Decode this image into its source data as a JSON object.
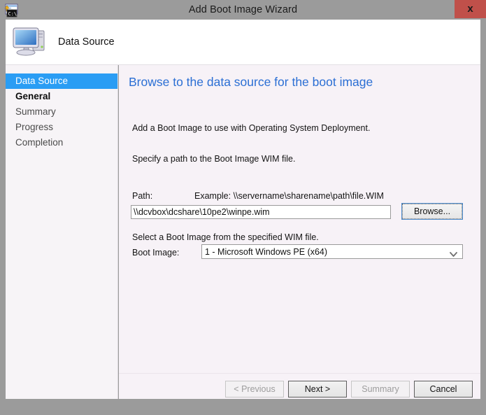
{
  "window": {
    "title": "Add Boot Image Wizard",
    "app_icon": "boot-image-icon",
    "close_label": "x"
  },
  "header": {
    "icon": "computer-icon",
    "title": "Data Source"
  },
  "sidebar": {
    "items": [
      {
        "label": "Data Source",
        "state": "selected"
      },
      {
        "label": "General",
        "state": "visited"
      },
      {
        "label": "Summary",
        "state": "normal"
      },
      {
        "label": "Progress",
        "state": "normal"
      },
      {
        "label": "Completion",
        "state": "normal"
      }
    ]
  },
  "main": {
    "heading": "Browse to the data source for the boot image",
    "intro_text": "Add a Boot Image to use with Operating System Deployment.",
    "specify_text": "Specify a path to the Boot Image WIM file.",
    "path_label": "Path:",
    "path_example": "Example: \\\\servername\\sharename\\path\\file.WIM",
    "path_value": "\\\\dcvbox\\dcshare\\10pe2\\winpe.wim",
    "path_placeholder": "",
    "browse_label": "Browse...",
    "select_hint": "Select a Boot Image from the specified WIM file.",
    "boot_image_label": "Boot Image:",
    "boot_image_selected": "1 - Microsoft Windows PE (x64)",
    "boot_image_options": [
      "1 - Microsoft Windows PE (x64)"
    ],
    "dropdown_icon": "chevron-down-icon"
  },
  "footer": {
    "previous_label": "< Previous",
    "next_label": "Next >",
    "summary_label": "Summary",
    "cancel_label": "Cancel"
  },
  "colors": {
    "accent_blue": "#2a9df4",
    "heading_blue": "#2b6fd4",
    "close_red": "#c0504a",
    "frame_gray": "#9b9b9b",
    "panel_bg": "#f7f2f7"
  }
}
